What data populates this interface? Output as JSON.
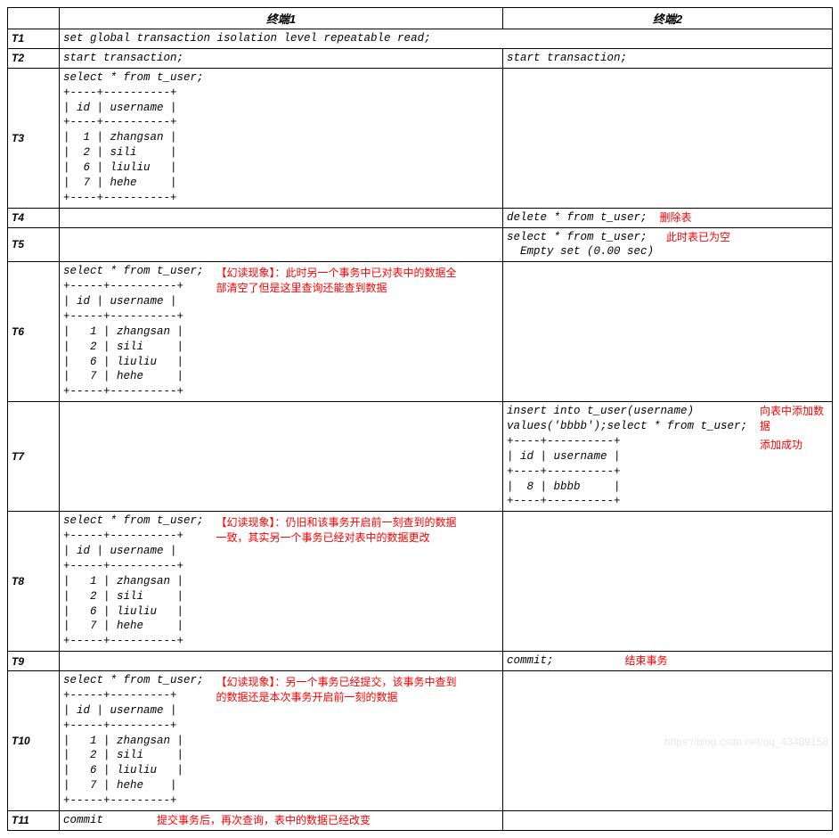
{
  "headers": {
    "term1": "终端1",
    "term2": "终端2"
  },
  "sep_full": "+----+----------+",
  "sep_short": "+----+----------+",
  "col_header": "| id | username |",
  "rows_4": [
    "|  1 | zhangsan |",
    "|  2 | sili     |",
    "|  6 | liuliu   |",
    "|  7 | hehe     |"
  ],
  "rows_bbbb": [
    "|  8 | bbbb     |"
  ],
  "rows_4v2": [
    "|   1 | zhangsan |",
    "|   2 | sili     |",
    "|   6 | liuliu   |",
    "|   7 | hehe     |"
  ],
  "rows_4v3": [
    "|   1 | zhangsan |",
    "|   2 | sili     |",
    "|   6 | liuliu   |",
    "|   7 | hehe    |"
  ],
  "steps": {
    "T1": {
      "term1": "set global transaction isolation level repeatable read;"
    },
    "T2": {
      "term1": "start transaction;",
      "term2": "start transaction;"
    },
    "T3": {
      "term1_cmd": "select * from t_user;"
    },
    "T4": {
      "term2": "delete * from t_user;",
      "anno2": "删除表"
    },
    "T5": {
      "term2": "select * from t_user;\n  Empty set (0.00 sec)",
      "anno2": "此时表已为空"
    },
    "T6": {
      "term1_cmd": "select * from t_user;",
      "anno1": "【幻读现象】：此时另一个事务中已对表中的数据全部清空了但是这里查询还能查到数据"
    },
    "T7": {
      "term2_cmd": "insert into t_user(username)\nvalues('bbbb');select * from t_user;",
      "anno2a": "向表中添加数据",
      "anno2b": "添加成功"
    },
    "T8": {
      "term1_cmd": "select * from t_user;",
      "anno1": "【幻读现象】：仍旧和该事务开启前一刻查到的数据一致，其实另一个事务已经对表中的数据更改"
    },
    "T9": {
      "term2": "commit;",
      "anno2": "结束事务"
    },
    "T10": {
      "term1_cmd": "select * from t_user;",
      "anno1": "【幻读现象】：另一个事务已经提交，该事务中查到的数据还是本次事务开启前一刻的数据"
    },
    "T11": {
      "term1": "commit",
      "anno1": "提交事务后，再次查询，表中的数据已经改变"
    }
  },
  "watermark": "https://blog.csdn.net/qq_43489158"
}
